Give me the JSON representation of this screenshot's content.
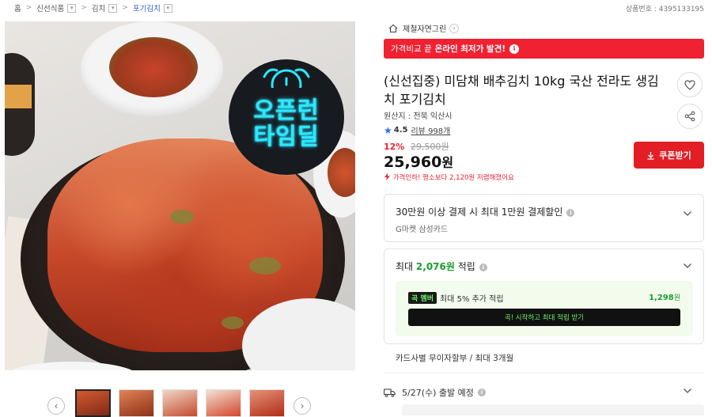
{
  "breadcrumb": {
    "items": [
      "홈",
      "신선식품",
      "김치",
      "포기김치"
    ]
  },
  "product_number": "상품번호 : 4395133195",
  "image": {
    "badge_line1": "오픈런",
    "badge_line2": "타임딜"
  },
  "store": {
    "name": "제철자연그린"
  },
  "banner": {
    "prefix": "가격비교 끝",
    "highlight": "온라인 최저가 발견!",
    "info": "i"
  },
  "product": {
    "title": "(신선집중) 미담채 배추김치 10kg 국산 전라도 생김치 포기김치",
    "origin": "원산지 : 전북 익산시",
    "rating": "4.5",
    "reviews": "리뷰 998개",
    "discount_pct": "12%",
    "original_price": "29,500원",
    "price_number": "25,960",
    "price_unit": "원",
    "price_note": "가격인하! 평소보다 2,120원 저렴해졌어요"
  },
  "buttons": {
    "coupon": "쿠폰받기"
  },
  "card_discount": {
    "title": "30만원 이상 결제 시 최대 1만원 결제할인",
    "sub": "G마켓 삼성카드"
  },
  "points": {
    "prefix": "최대 ",
    "amount": "2,076원",
    "suffix": " 적립",
    "member_logo": "곡 멤버",
    "member_text": "최대 5% 추가 적립",
    "member_amount": "1,298",
    "member_unit": "원",
    "member_cta": "곡! 시작하고 최대 적립 받기"
  },
  "installment": "카드사별 무이자할부 / 최대 3개월",
  "shipping": "5/27(수) 출발 예정",
  "colors": {
    "accent_red": "#f02131",
    "coupon_red": "#e31e24",
    "points_green": "#1a9d2e",
    "badge_cyan": "#27e9ff",
    "link_blue": "#2f5bd3"
  }
}
